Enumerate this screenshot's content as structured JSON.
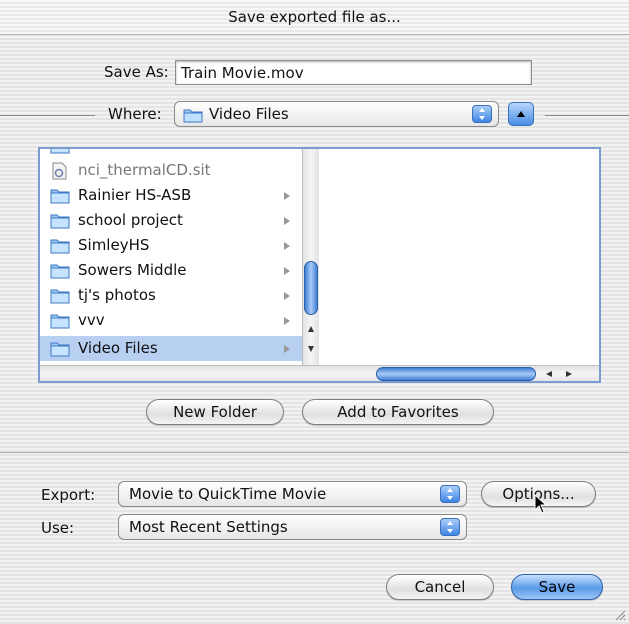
{
  "window": {
    "title": "Save exported file as..."
  },
  "save_as": {
    "label": "Save As:",
    "value": "Train Movie.mov"
  },
  "where": {
    "label": "Where:",
    "value": "Video Files"
  },
  "browser": {
    "items": [
      {
        "name": "nci_thermalCD.sit",
        "type": "file",
        "dimmed": true
      },
      {
        "name": "Rainier HS-ASB",
        "type": "folder"
      },
      {
        "name": "school project",
        "type": "folder"
      },
      {
        "name": "SimleyHS",
        "type": "folder"
      },
      {
        "name": "Sowers Middle",
        "type": "folder"
      },
      {
        "name": "tj's photos",
        "type": "folder"
      },
      {
        "name": "vvv",
        "type": "folder"
      },
      {
        "name": "Video Files",
        "type": "folder",
        "selected": true
      }
    ]
  },
  "buttons": {
    "new_folder": "New Folder",
    "add_favorites": "Add to Favorites",
    "options": "Options...",
    "cancel": "Cancel",
    "save": "Save"
  },
  "export": {
    "label": "Export:",
    "value": "Movie to QuickTime Movie"
  },
  "use": {
    "label": "Use:",
    "value": "Most Recent Settings"
  },
  "colors": {
    "accent": "#3f86e5",
    "selection": "#b7cff1"
  }
}
